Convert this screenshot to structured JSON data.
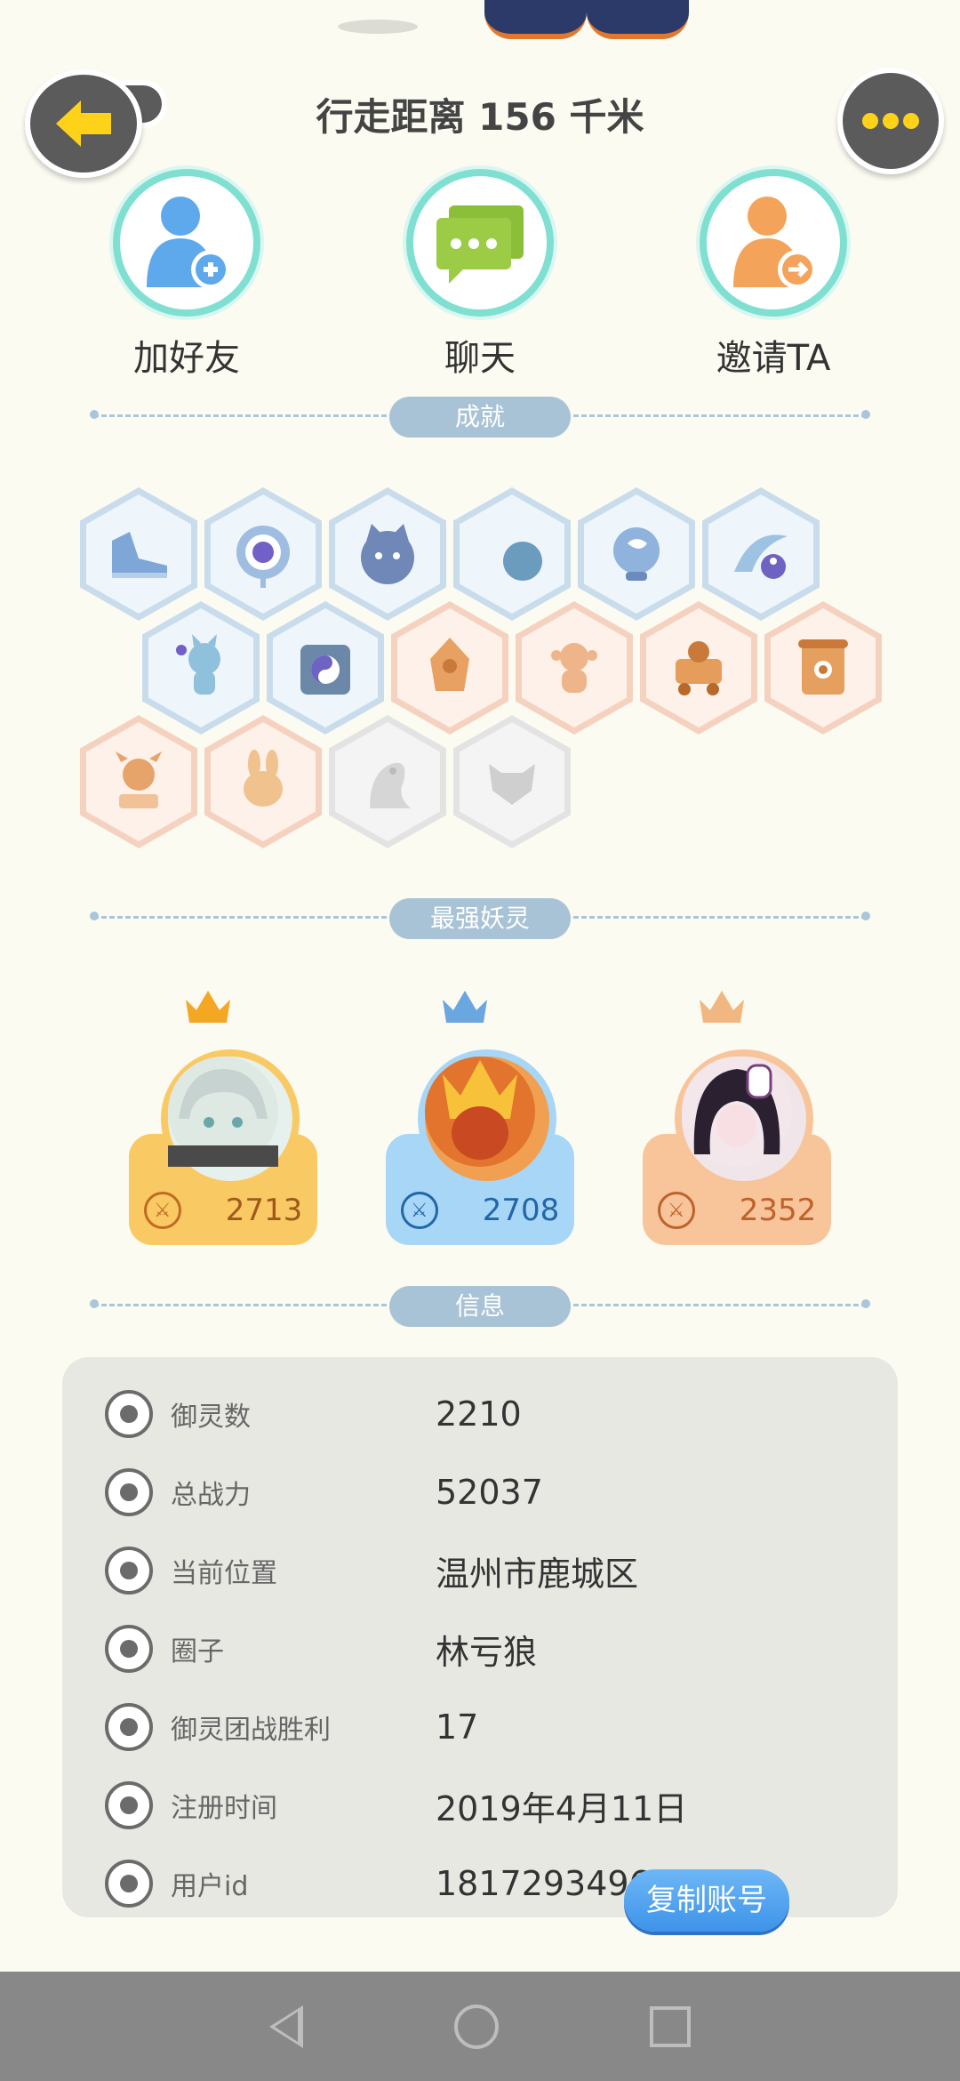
{
  "header": {
    "title": "行走距离 156 千米"
  },
  "actions": [
    {
      "label": "加好友"
    },
    {
      "label": "聊天"
    },
    {
      "label": "邀请TA"
    }
  ],
  "sections": {
    "achievements": "成就",
    "strongest": "最强妖灵",
    "info": "信息"
  },
  "strongest_spirits": [
    {
      "power": "2713",
      "color": "#f9c964"
    },
    {
      "power": "2708",
      "color": "#a8d6f7"
    },
    {
      "power": "2352",
      "color": "#f8c49a"
    }
  ],
  "info": [
    {
      "key": "御灵数",
      "value": "2210",
      "icon": "spirit-count-icon"
    },
    {
      "key": "总战力",
      "value": "52037",
      "icon": "sword-icon"
    },
    {
      "key": "当前位置",
      "value": "温州市鹿城区",
      "icon": "location-icon"
    },
    {
      "key": "圈子",
      "value": "林亏狼",
      "icon": "circle-icon"
    },
    {
      "key": "御灵团战胜利",
      "value": "17",
      "icon": "anchor-icon"
    },
    {
      "key": "注册时间",
      "value": "2019年4月11日",
      "icon": "clock-icon"
    },
    {
      "key": "用户id",
      "value": "18172934968",
      "icon": "id-card-icon"
    }
  ],
  "copy_button": "复制账号",
  "colors": {
    "accent_blue": "#3e93ea",
    "divider": "#a9c6dc",
    "panel": "#e8e8e3"
  }
}
